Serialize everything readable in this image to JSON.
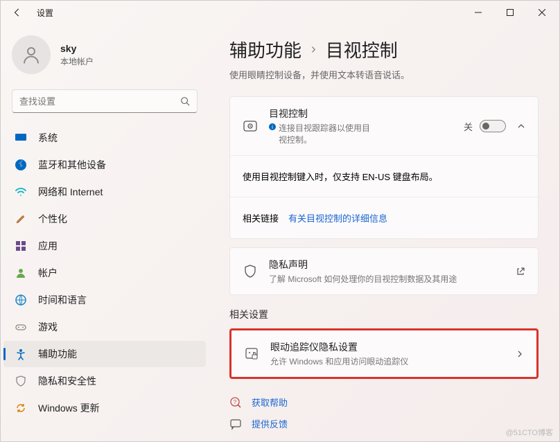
{
  "titlebar": {
    "title": "设置"
  },
  "profile": {
    "name": "sky",
    "sub": "本地帐户"
  },
  "search": {
    "placeholder": "查找设置"
  },
  "nav": [
    {
      "label": "系统"
    },
    {
      "label": "蓝牙和其他设备"
    },
    {
      "label": "网络和 Internet"
    },
    {
      "label": "个性化"
    },
    {
      "label": "应用"
    },
    {
      "label": "帐户"
    },
    {
      "label": "时间和语言"
    },
    {
      "label": "游戏"
    },
    {
      "label": "辅助功能"
    },
    {
      "label": "隐私和安全性"
    },
    {
      "label": "Windows 更新"
    }
  ],
  "breadcrumb": {
    "parent": "辅助功能",
    "current": "目视控制"
  },
  "subtitle": "使用眼睛控制设备，并使用文本转语音说话。",
  "eyecontrol": {
    "title": "目视控制",
    "sub": "连接目视跟踪器以使用目视控制。",
    "toggleLabel": "关",
    "note": "使用目视控制键入时，仅支持 EN-US 键盘布局。",
    "linksLabel": "相关链接",
    "link": "有关目视控制的详细信息"
  },
  "privacy": {
    "title": "隐私声明",
    "sub": "了解 Microsoft 如何处理你的目视控制数据及其用途"
  },
  "relatedTitle": "相关设置",
  "trackers": {
    "title": "眼动追踪仪隐私设置",
    "sub": "允许 Windows 和应用访问眼动追踪仪"
  },
  "footer": {
    "help": "获取帮助",
    "feedback": "提供反馈"
  },
  "watermark": "@51CTO博客"
}
